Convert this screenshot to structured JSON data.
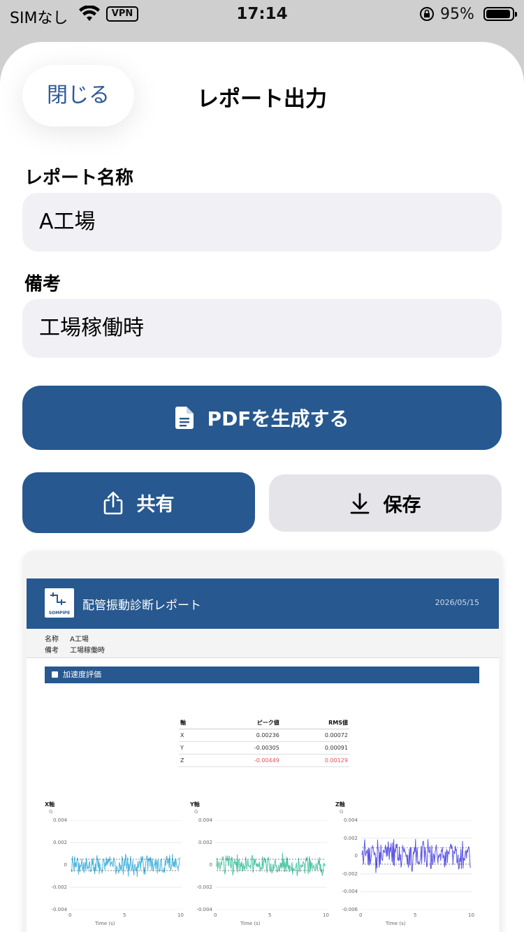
{
  "status_bar": {
    "carrier": "SIMなし",
    "vpn": "VPN",
    "time": "17:14",
    "battery": "95%",
    "battery_level": 0.95
  },
  "sheet": {
    "close_label": "閉じる",
    "title": "レポート出力"
  },
  "form": {
    "name_label": "レポート名称",
    "name_value": "A工場",
    "note_label": "備考",
    "note_value": "工場稼働時"
  },
  "actions": {
    "generate_label": "PDFを生成する",
    "share_label": "共有",
    "save_label": "保存"
  },
  "colors": {
    "primary": "#27588f",
    "x_series": "#4bb6e0",
    "y_series": "#4cc7a6",
    "z_series": "#5b55e8",
    "alert": "#e05555"
  },
  "preview": {
    "logo_text": "SOMPIPE",
    "title": "配管振動診断レポート",
    "date": "2026/05/15",
    "info": [
      {
        "key": "名称",
        "value": "A工場"
      },
      {
        "key": "備考",
        "value": "工場稼働時"
      }
    ],
    "section_title": "加速度評価",
    "table": {
      "headers": [
        "軸",
        "ピーク値",
        "RMS値"
      ],
      "rows": [
        {
          "axis": "X",
          "peak": "0.00236",
          "rms": "0.00072",
          "alert": false
        },
        {
          "axis": "Y",
          "peak": "-0.00305",
          "rms": "0.00091",
          "alert": false
        },
        {
          "axis": "Z",
          "peak": "-0.00449",
          "rms": "0.00129",
          "alert": true
        }
      ]
    },
    "plots": [
      {
        "title": "X軸",
        "unit": "G",
        "yticks": [
          "0.004",
          "0.002",
          "0",
          "-0.002",
          "-0.004"
        ],
        "xticks": [
          "0",
          "5",
          "10"
        ],
        "xlabel": "Time (s)",
        "color": "#4bb6e0"
      },
      {
        "title": "Y軸",
        "unit": "G",
        "yticks": [
          "0.004",
          "0.002",
          "0",
          "-0.002",
          "-0.004"
        ],
        "xticks": [
          "0",
          "5",
          "10"
        ],
        "xlabel": "Time (s)",
        "color": "#4cc7a6"
      },
      {
        "title": "Z軸",
        "unit": "G",
        "yticks": [
          "0.004",
          "0.002",
          "0",
          "-0.002",
          "-0.004",
          "-0.006"
        ],
        "xticks": [
          "0",
          "5",
          "10"
        ],
        "xlabel": "Time (s)",
        "color": "#5b55e8"
      }
    ]
  }
}
